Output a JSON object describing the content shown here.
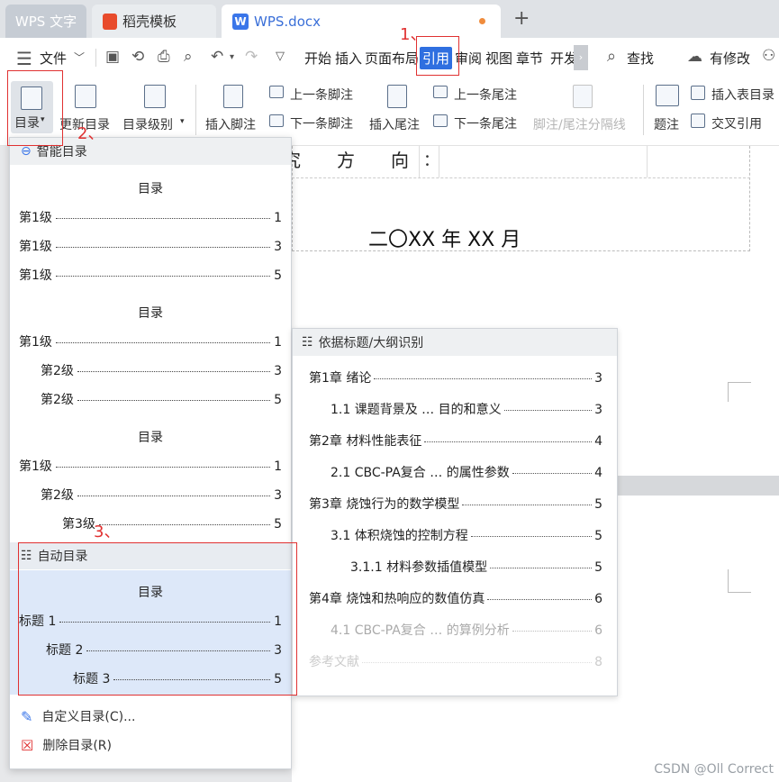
{
  "tabs": {
    "app": "WPS 文字",
    "template": "稻壳模板",
    "document": "WPS.docx"
  },
  "menu": {
    "file": "文件",
    "items": [
      "开始",
      "插入",
      "页面布局",
      "引用",
      "审阅",
      "视图",
      "章节",
      "开发"
    ],
    "search": "查找",
    "modified": "有修改"
  },
  "ribbon": {
    "toc": "目录",
    "update_toc": "更新目录",
    "toc_level": "目录级别",
    "insert_footnote": "插入脚注",
    "prev_footnote": "上一条脚注",
    "next_footnote": "下一条脚注",
    "insert_endnote": "插入尾注",
    "prev_endnote": "上一条尾注",
    "next_endnote": "下一条尾注",
    "separator": "脚注/尾注分隔线",
    "caption": "题注",
    "insert_table_toc": "插入表目录",
    "cross_ref": "交叉引用"
  },
  "doc": {
    "direction": "究　　方　　向",
    "colon": "：",
    "date": "二〇XX 年 XX 月"
  },
  "dropdown": {
    "smart_header": "智能目录",
    "toc1": {
      "title": "目录",
      "rows": [
        {
          "label": "第1级",
          "page": "1"
        },
        {
          "label": "第1级",
          "page": "3"
        },
        {
          "label": "第1级",
          "page": "5"
        }
      ]
    },
    "toc2": {
      "title": "目录",
      "rows": [
        {
          "label": "第1级",
          "page": "1"
        },
        {
          "label": "第2级",
          "page": "3"
        },
        {
          "label": "第2级",
          "page": "5"
        }
      ]
    },
    "toc3": {
      "title": "目录",
      "rows": [
        {
          "label": "第1级",
          "page": "1"
        },
        {
          "label": "第2级",
          "page": "3"
        },
        {
          "label": "第3级",
          "page": "5"
        }
      ]
    },
    "auto_header": "自动目录",
    "auto": {
      "title": "目录",
      "rows": [
        {
          "label": "标题 1",
          "page": "1"
        },
        {
          "label": "标题 2",
          "page": "3"
        },
        {
          "label": "标题 3",
          "page": "5"
        }
      ]
    },
    "custom": "自定义目录(C)...",
    "delete": "删除目录(R)"
  },
  "preview": {
    "header": "依据标题/大纲识别",
    "rows": [
      {
        "label": "第1章 绪论",
        "page": "3"
      },
      {
        "label": "1.1 课题背景及 … 目的和意义",
        "page": "3"
      },
      {
        "label": "第2章 材料性能表征",
        "page": "4"
      },
      {
        "label": "2.1 CBC-PA复合 … 的属性参数",
        "page": "4"
      },
      {
        "label": "第3章 烧蚀行为的数学模型",
        "page": "5"
      },
      {
        "label": "3.1 体积烧蚀的控制方程",
        "page": "5"
      },
      {
        "label": "3.1.1 材料参数插值模型",
        "page": "5"
      },
      {
        "label": "第4章 烧蚀和热响应的数值仿真",
        "page": "6"
      },
      {
        "label": "4.1 CBC-PA复合 … 的算例分析",
        "page": "6"
      },
      {
        "label": "参考文献",
        "page": "8"
      }
    ]
  },
  "annotations": {
    "step1": "1、",
    "step2": "2、",
    "step3": "3、"
  },
  "watermark": "CSDN @Oll Correct",
  "colors": {
    "accent": "#3a76e9",
    "annotation": "#e03131"
  }
}
